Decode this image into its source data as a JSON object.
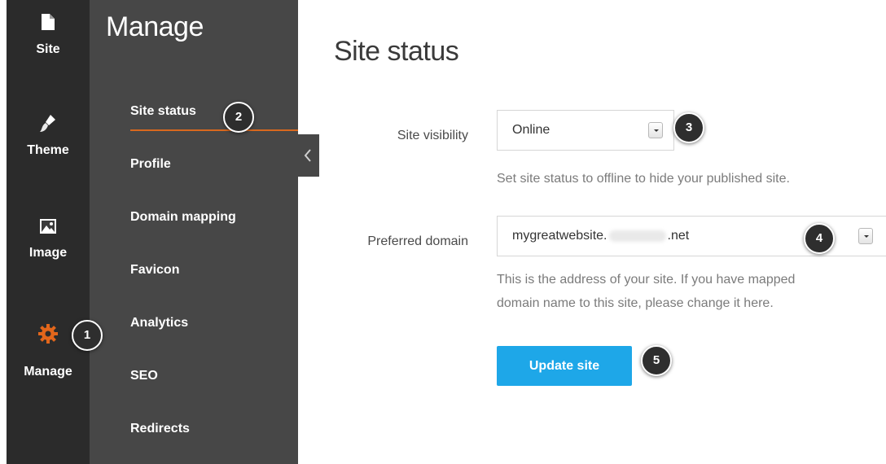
{
  "rail": {
    "items": [
      {
        "label": "Site",
        "icon": "file-icon"
      },
      {
        "label": "Theme",
        "icon": "paintbrush-icon"
      },
      {
        "label": "Image",
        "icon": "image-icon"
      },
      {
        "label": "Manage",
        "icon": "gear-icon"
      }
    ],
    "active_icon_color": "#e2661b"
  },
  "nav": {
    "title": "Manage",
    "items": [
      {
        "label": "Site status"
      },
      {
        "label": "Profile"
      },
      {
        "label": "Domain mapping"
      },
      {
        "label": "Favicon"
      },
      {
        "label": "Analytics"
      },
      {
        "label": "SEO"
      },
      {
        "label": "Redirects"
      }
    ],
    "accent": "#d8681e"
  },
  "main": {
    "title": "Site status",
    "visibility": {
      "label": "Site visibility",
      "value": "Online",
      "help": "Set site status to offline to hide your published site."
    },
    "domain": {
      "label": "Preferred domain",
      "value_prefix": "mygreatwebsite.",
      "value_suffix": ".net",
      "help_line1": "This is the address of your site. If you have mapped",
      "help_line2": "domain name to this site, please change it here."
    },
    "update_button": "Update site",
    "button_color": "#1ea7e8"
  },
  "badges": [
    "1",
    "2",
    "3",
    "4",
    "5"
  ]
}
